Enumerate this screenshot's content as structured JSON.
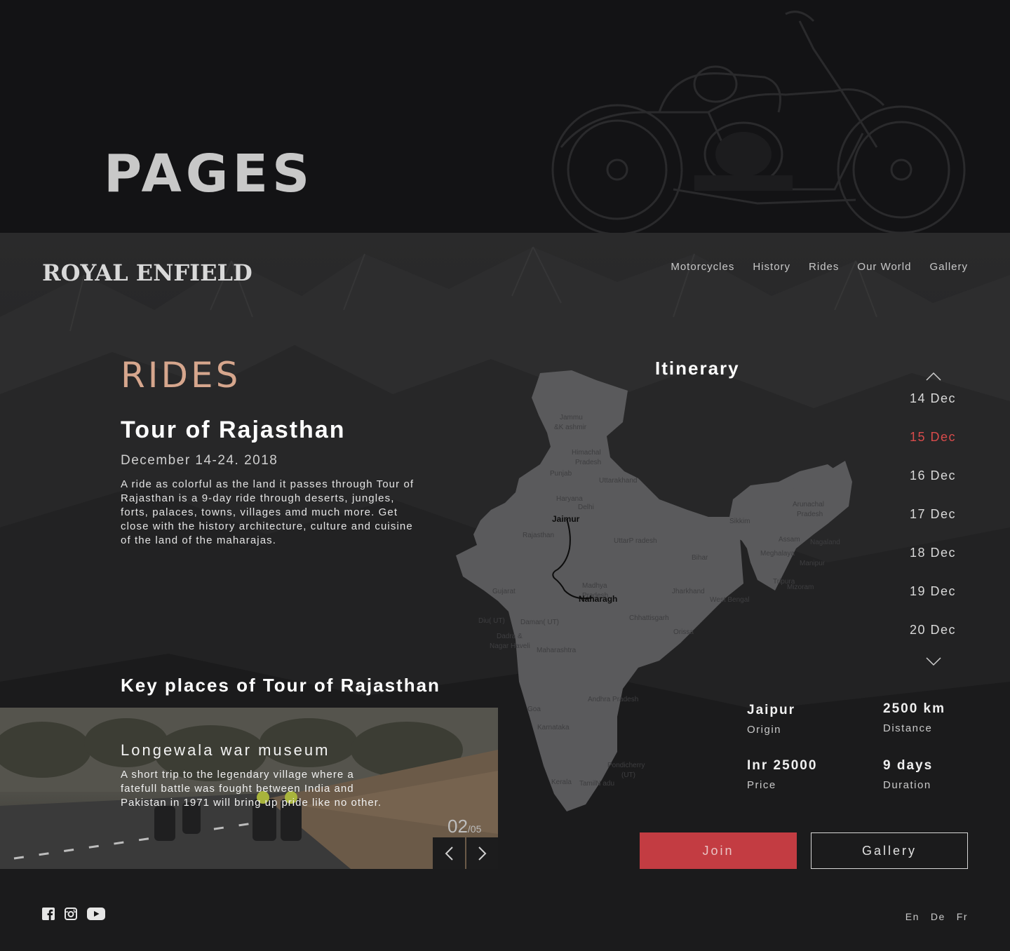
{
  "banner": {
    "title": "PAGES"
  },
  "header": {
    "logo": "ROYAL ENFIELD",
    "nav": [
      "Motorcycles",
      "History",
      "Rides",
      "Our World",
      "Gallery"
    ]
  },
  "ride": {
    "section_label": "RIDES",
    "title": "Tour of Rajasthan",
    "date": "December 14-24. 2018",
    "description": "A ride as colorful as the land it passes through Tour of Rajasthan is a 9-day ride through deserts, jungles, forts, palaces, towns, villages amd much more. Get close with the history architecture, culture and cuisine of the land  of the maharajas."
  },
  "key_places": {
    "title": "Key places of Tour of Rajasthan",
    "current": {
      "name": "Longewala war museum",
      "description": "A short trip to the legendary  village where a fatefull battle was fought between India and Pakistan in 1971 will bring up pride like no other."
    },
    "pager_current": "02",
    "pager_total": "/05",
    "prev_icon": "chevron-left-icon",
    "next_icon": "chevron-right-icon"
  },
  "map": {
    "labels": {
      "jk": "Jammu",
      "jk2": "&K ashmir",
      "hp": "Himachal",
      "hp2": "Pradesh",
      "pb": "Punjab",
      "uk": "Uttarakhand",
      "hr": "Haryana",
      "dl": "Delhi",
      "rj": "Rajasthan",
      "up": "UttarP radesh",
      "bh": "Bihar",
      "sk": "Sikkim",
      "ar": "Arunachal",
      "ar2": "Pradesh",
      "as": "Assam",
      "nl": "Nagaland",
      "ml": "Meghalaya",
      "mn": "Manipur",
      "tr": "Tripura",
      "mz": "Mizoram",
      "gj": "Gujarat",
      "mp": "Madhya",
      "mp2": "Pradesh",
      "jh": "Jharkhand",
      "wb": "West Bengal",
      "dd": "Diu( UT)",
      "dm": "Daman(  UT)",
      "dn": "Dadra &",
      "dn2": "Nagar Haveli",
      "cg": "Chhattisgarh",
      "od": "Orissa",
      "mh": "Maharashtra",
      "ap": "Andhra Pradesh",
      "ga": "Goa",
      "ka": "Karnataka",
      "py": "Pondicherry",
      "py2": "(UT)",
      "kl": "Kerala",
      "tn": "TamilN adu"
    },
    "route_start": "Jaimur",
    "route_end": "Naharagh"
  },
  "itinerary": {
    "title": "Itinerary",
    "dates": [
      "14 Dec",
      "15 Dec",
      "16 Dec",
      "17 Dec",
      "18 Dec",
      "19 Dec",
      "20 Dec"
    ],
    "active_index": 1,
    "up_icon": "chevron-up-icon",
    "down_icon": "chevron-down-icon"
  },
  "stats": {
    "origin": {
      "value": "Jaipur",
      "label": "Origin"
    },
    "distance": {
      "value": "2500 km",
      "label": "Distance"
    },
    "price": {
      "value": "Inr 25000",
      "label": "Price"
    },
    "duration": {
      "value": "9 days",
      "label": "Duration"
    }
  },
  "actions": {
    "join": "Join",
    "gallery": "Gallery"
  },
  "footer": {
    "socials": [
      "facebook-icon",
      "instagram-icon",
      "youtube-icon"
    ],
    "languages": [
      "En",
      "De",
      "Fr"
    ]
  },
  "colors": {
    "accent": "#c33c42",
    "active_date": "#d84b4b",
    "rides_label": "#d6a68d"
  }
}
